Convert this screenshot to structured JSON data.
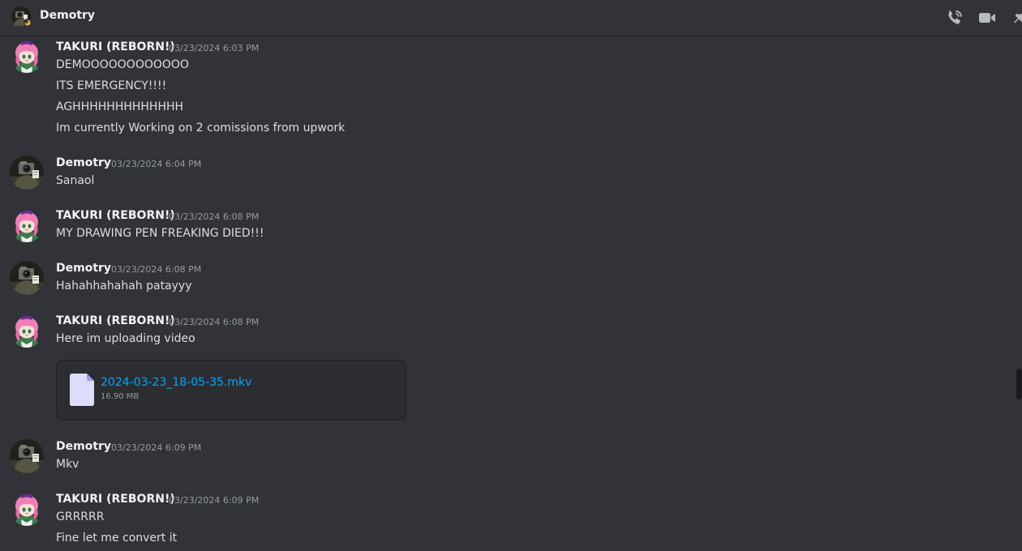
{
  "header": {
    "title": "Demotry",
    "icons": [
      "phone-call-icon",
      "video-camera-icon",
      "pin-icon"
    ]
  },
  "colors": {
    "background": "#313338",
    "username": "#f2f3f5",
    "text": "#dbdee1",
    "timestamp": "#949ba4",
    "link": "#00a8fc"
  },
  "messages": [
    {
      "author": "TAKURI (REBORN!)",
      "timestamp": "03/23/2024 6:03 PM",
      "lines": [
        "DEMOOOOOOOOOOOO",
        "ITS EMERGENCY!!!!",
        "AGHHHHHHHHHHHHH",
        "Im currently Working on 2 comissions from upwork"
      ]
    },
    {
      "author": "Demotry",
      "timestamp": "03/23/2024 6:04 PM",
      "lines": [
        "Sanaol"
      ]
    },
    {
      "author": "TAKURI (REBORN!)",
      "timestamp": "03/23/2024 6:08 PM",
      "lines": [
        "MY DRAWING PEN FREAKING DIED!!!"
      ]
    },
    {
      "author": "Demotry",
      "timestamp": "03/23/2024 6:08 PM",
      "lines": [
        "Hahahhahahah patayyy"
      ]
    },
    {
      "author": "TAKURI (REBORN!)",
      "timestamp": "03/23/2024 6:08 PM",
      "lines": [
        "Here im uploading video"
      ],
      "attachment": {
        "file_name": "2024-03-23_18-05-35.mkv",
        "file_size": "16.90 MB",
        "icon": "file-icon"
      }
    },
    {
      "author": "Demotry",
      "timestamp": "03/23/2024 6:09 PM",
      "lines": [
        "Mkv"
      ]
    },
    {
      "author": "TAKURI (REBORN!)",
      "timestamp": "03/23/2024 6:09 PM",
      "lines": [
        "GRRRRR",
        "Fine let me convert it"
      ]
    }
  ]
}
